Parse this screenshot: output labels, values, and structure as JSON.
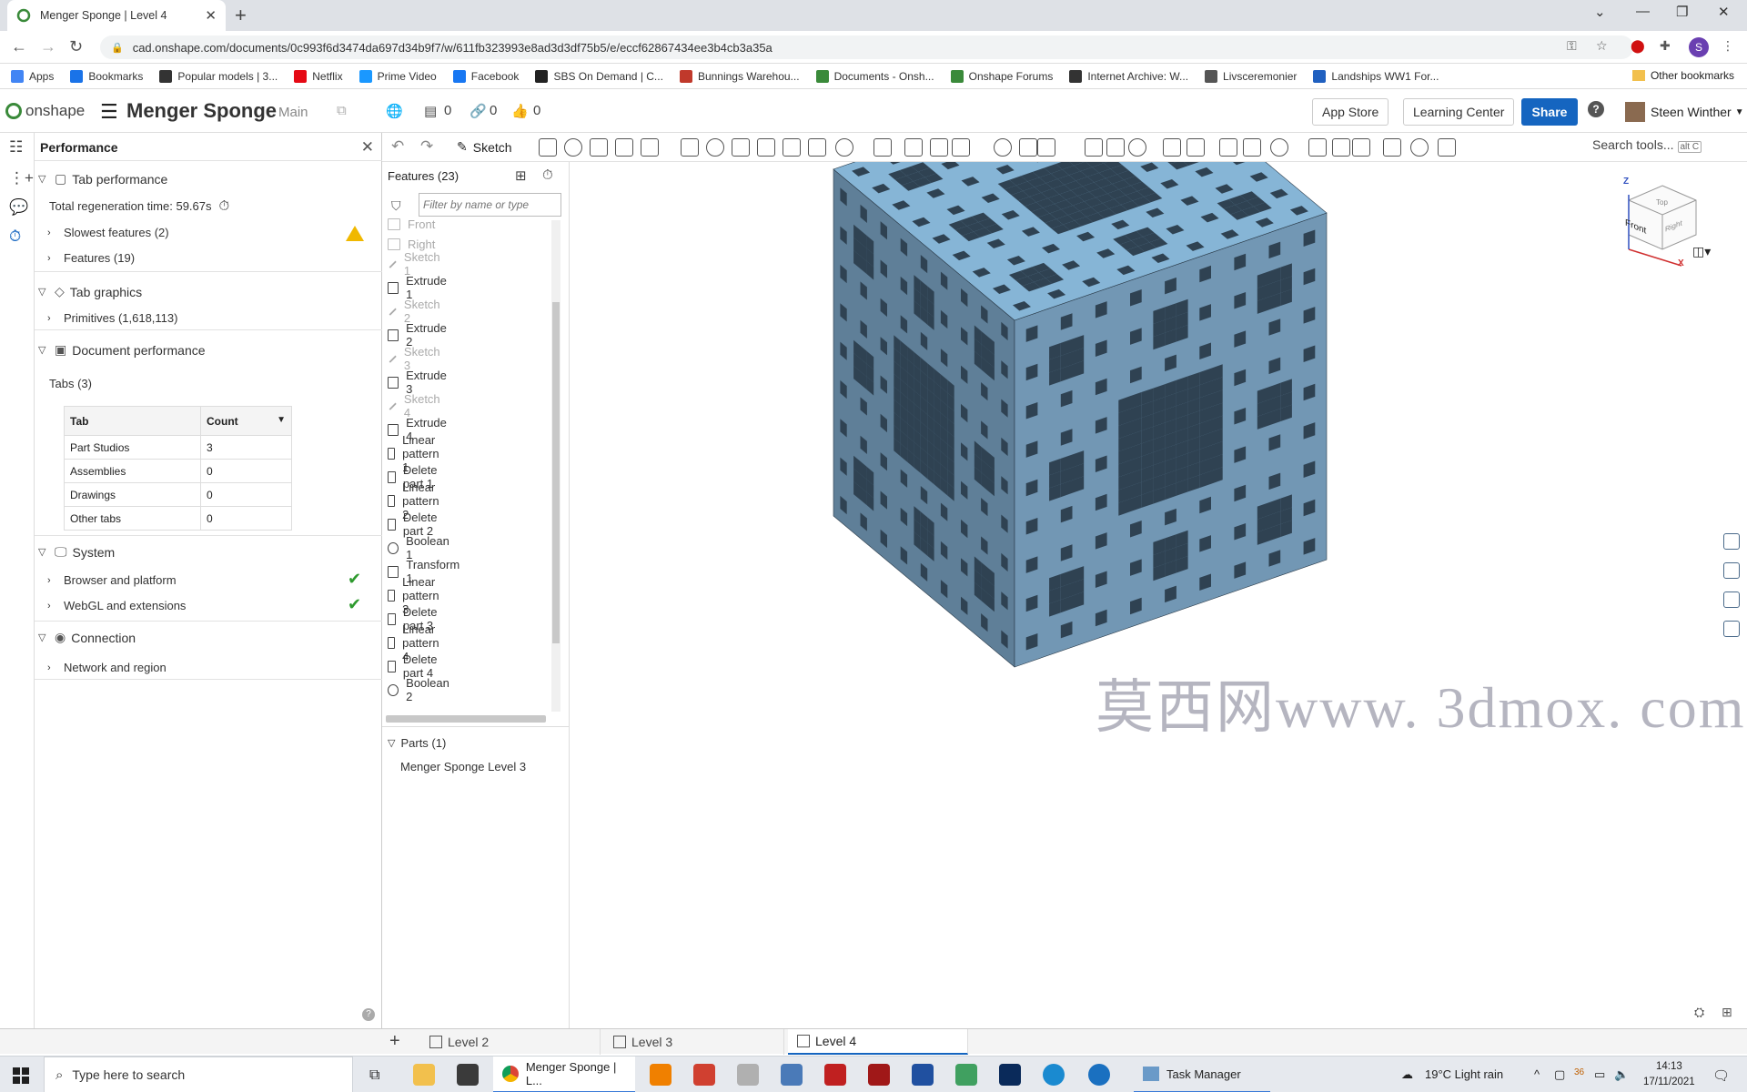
{
  "browser": {
    "tab_title": "Menger Sponge | Level 4",
    "url": "cad.onshape.com/documents/0c993f6d3474da697d34b9f7/w/611fb323993e8ad3d3df75b5/e/eccf62867434ee3b4cb3a35a",
    "bookmarks": [
      "Apps",
      "Bookmarks",
      "Popular models | 3...",
      "Netflix",
      "Prime Video",
      "Facebook",
      "SBS On Demand | C...",
      "Bunnings Warehou...",
      "Documents - Onsh...",
      "Onshape Forums",
      "Internet Archive: W...",
      "Livsceremonier",
      "Landships WW1 For..."
    ],
    "other_bookmarks": "Other bookmarks",
    "profile_letter": "S"
  },
  "header": {
    "logo": "onshape",
    "doc_name": "Menger Sponge",
    "branch": "Main",
    "versions_count": "0",
    "links_count": "0",
    "likes_count": "0",
    "app_store": "App Store",
    "learning_center": "Learning Center",
    "share": "Share",
    "help": "?",
    "user": "Steen Winther"
  },
  "perf": {
    "title": "Performance",
    "tab_perf": "Tab performance",
    "total_regen": "Total regeneration time: 59.67s",
    "slowest": "Slowest features (2)",
    "features": "Features (19)",
    "tab_graphics": "Tab graphics",
    "primitives": "Primitives (1,618,113)",
    "doc_perf": "Document performance",
    "tabs_label": "Tabs (3)",
    "table_head": [
      "Tab",
      "Count"
    ],
    "table_rows": [
      [
        "Part Studios",
        "3"
      ],
      [
        "Assemblies",
        "0"
      ],
      [
        "Drawings",
        "0"
      ],
      [
        "Other tabs",
        "0"
      ]
    ],
    "system": "System",
    "browser_platform": "Browser and platform",
    "webgl": "WebGL and extensions",
    "connection": "Connection",
    "network": "Network and region"
  },
  "features": {
    "title": "Features (23)",
    "filter_placeholder": "Filter by name or type",
    "items": [
      "Front",
      "Right",
      "Sketch 1",
      "Extrude 1",
      "Sketch 2",
      "Extrude 2",
      "Sketch 3",
      "Extrude 3",
      "Sketch 4",
      "Extrude 4",
      "Linear pattern 1",
      "Delete part 1",
      "Linear pattern 2",
      "Delete part 2",
      "Boolean 1",
      "Transform 1",
      "Linear pattern 3",
      "Delete part 3",
      "Linear pattern 4",
      "Delete part 4",
      "Boolean 2"
    ],
    "parts_title": "Parts (1)",
    "part": "Menger Sponge Level 3"
  },
  "toolbar": {
    "sketch": "Sketch",
    "search_tools": "Search tools...",
    "search_kbd": "alt C"
  },
  "viewcube": {
    "top": "Top",
    "front": "Front",
    "right": "Right",
    "axis_z": "Z",
    "axis_x": "X"
  },
  "watermark": {
    "cjk": "莫西网",
    "latin": "www. 3dmox. com"
  },
  "bottom_tabs": [
    "Level 2",
    "Level 3",
    "Level 4"
  ],
  "taskbar": {
    "search": "Type here to search",
    "active_app": "Menger Sponge | L...",
    "task_manager": "Task Manager",
    "weather": "19°C  Light rain",
    "time": "14:13",
    "date": "17/11/2021",
    "tray_badge": "36"
  },
  "colors": {
    "sponge_top": "#86b5d6",
    "sponge_left": "#5f7f98",
    "sponge_right": "#7297b4",
    "accent": "#1565c0"
  }
}
